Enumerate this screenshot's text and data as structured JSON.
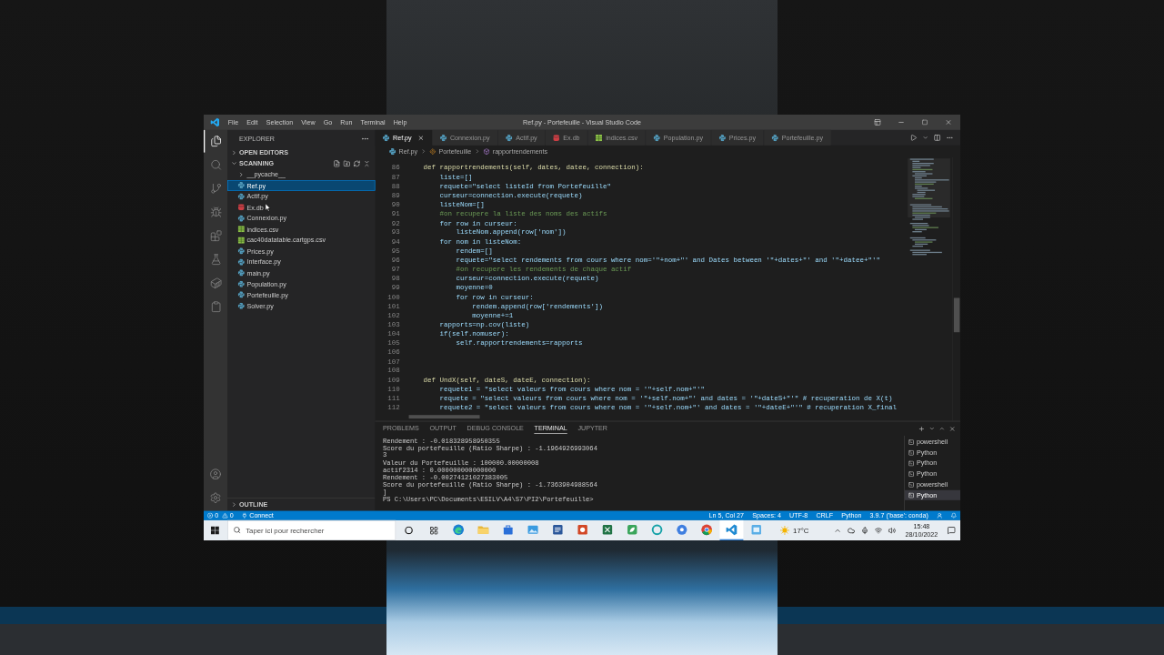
{
  "window": {
    "title": "Ref.py - Portefeuille - Visual Studio Code"
  },
  "menu": [
    "File",
    "Edit",
    "Selection",
    "View",
    "Go",
    "Run",
    "Terminal",
    "Help"
  ],
  "activity_bar": [
    {
      "selected": true
    },
    {
      "selected": false
    },
    {
      "selected": false
    },
    {
      "selected": false
    },
    {
      "selected": false
    },
    {
      "selected": false
    },
    {
      "selected": false
    },
    {
      "selected": false
    }
  ],
  "sidebar": {
    "title": "EXPLORER",
    "open_editors": {
      "label": "OPEN EDITORS",
      "expanded": false
    },
    "folder": {
      "label": "SCANNING",
      "expanded": true
    },
    "files": [
      {
        "name": "__pycache__",
        "kind": "folder",
        "selected": false
      },
      {
        "name": "Ref.py",
        "kind": "python",
        "selected": true
      },
      {
        "name": "Actif.py",
        "kind": "python",
        "selected": false
      },
      {
        "name": "Ex.db",
        "kind": "database",
        "selected": false
      },
      {
        "name": "Connexion.py",
        "kind": "python",
        "selected": false
      },
      {
        "name": "indices.csv",
        "kind": "csv",
        "selected": false
      },
      {
        "name": "cac40datatable.cartgps.csv",
        "kind": "csv",
        "selected": false
      },
      {
        "name": "Prices.py",
        "kind": "python",
        "selected": false
      },
      {
        "name": "Interface.py",
        "kind": "python",
        "selected": false
      },
      {
        "name": "main.py",
        "kind": "python",
        "selected": false
      },
      {
        "name": "Population.py",
        "kind": "python",
        "selected": false
      },
      {
        "name": "Portefeuille.py",
        "kind": "python",
        "selected": false
      },
      {
        "name": "Solver.py",
        "kind": "python",
        "selected": false
      }
    ],
    "outline": {
      "label": "OUTLINE",
      "expanded": false
    }
  },
  "editor": {
    "tabs": [
      {
        "label": "Ref.py",
        "kind": "python",
        "selected": true
      },
      {
        "label": "Connexion.py",
        "kind": "python",
        "selected": false
      },
      {
        "label": "Actif.py",
        "kind": "python",
        "selected": false
      },
      {
        "label": "Ex.db",
        "kind": "database",
        "selected": false
      },
      {
        "label": "indices.csv",
        "kind": "csv",
        "selected": false
      },
      {
        "label": "Population.py",
        "kind": "python",
        "selected": false
      },
      {
        "label": "Prices.py",
        "kind": "python",
        "selected": false
      },
      {
        "label": "Portefeuille.py",
        "kind": "python",
        "selected": false
      }
    ],
    "breadcrumb": [
      {
        "label": "Ref.py",
        "kind": "file"
      },
      {
        "label": "Portefeuille",
        "kind": "class"
      },
      {
        "label": "rapportrendements",
        "kind": "method"
      }
    ],
    "lines": [
      {
        "number": "86",
        "kind": "def",
        "text": "    def rapportrendements(self, dates, datee, connection):"
      },
      {
        "number": "87",
        "kind": "code",
        "text": "        liste=[]"
      },
      {
        "number": "88",
        "kind": "code",
        "text": "        requete=\"select listeId from Portefeuille\""
      },
      {
        "number": "89",
        "kind": "code",
        "text": "        curseur=connection.execute(requete)"
      },
      {
        "number": "90",
        "kind": "code",
        "text": "        listeNom=[]"
      },
      {
        "number": "91",
        "kind": "comment",
        "text": "        #on recupere la liste des noms des actifs"
      },
      {
        "number": "92",
        "kind": "code",
        "text": "        for row in curseur:"
      },
      {
        "number": "93",
        "kind": "code",
        "text": "            listeNom.append(row['nom'])"
      },
      {
        "number": "94",
        "kind": "code",
        "text": "        for nom in listeNom:"
      },
      {
        "number": "95",
        "kind": "code",
        "text": "            rendem=[]"
      },
      {
        "number": "96",
        "kind": "code",
        "text": "            requete=\"select rendements from cours where nom='\"+nom+\"' and Dates between '\"+dates+\"' and '\"+datee+\"'\""
      },
      {
        "number": "97",
        "kind": "comment",
        "text": "            #on recupere les rendements de chaque actif"
      },
      {
        "number": "98",
        "kind": "code",
        "text": "            curseur=connection.execute(requete)"
      },
      {
        "number": "99",
        "kind": "code",
        "text": "            moyenne=0"
      },
      {
        "number": "100",
        "kind": "code",
        "text": "            for row in curseur:"
      },
      {
        "number": "101",
        "kind": "code",
        "text": "                rendem.append(row['rendements'])"
      },
      {
        "number": "102",
        "kind": "code",
        "text": "                moyenne+=1"
      },
      {
        "number": "103",
        "kind": "code",
        "text": "        rapports=np.cov(liste)"
      },
      {
        "number": "104",
        "kind": "code",
        "text": "        if(self.nomuser):"
      },
      {
        "number": "105",
        "kind": "code",
        "text": "            self.rapportrendements=rapports"
      },
      {
        "number": "106",
        "kind": "blank"
      },
      {
        "number": "107",
        "kind": "blank"
      },
      {
        "number": "108",
        "kind": "blank"
      },
      {
        "number": "109",
        "kind": "def",
        "text": "    def UndX(self, dateS, dateE, connection):"
      },
      {
        "number": "110",
        "kind": "code",
        "text": "        requete1 = \"select valeurs from cours where nom = '\"+self.nom+\"'\""
      },
      {
        "number": "111",
        "kind": "code",
        "text": "        requete = \"select valeurs from cours where nom = '\"+self.nom+\"' and dates = '\"+dateS+\"'\" # recuperation de X(t)"
      },
      {
        "number": "112",
        "kind": "code",
        "text": "        requete2 = \"select valeurs from cours where nom = '\"+self.nom+\"' and dates = '\"+dateE+\"'\" # recuperation X_final"
      }
    ]
  },
  "panel": {
    "tabs": [
      {
        "label": "PROBLEMS",
        "selected": false
      },
      {
        "label": "OUTPUT",
        "selected": false
      },
      {
        "label": "DEBUG CONSOLE",
        "selected": false
      },
      {
        "label": "TERMINAL",
        "selected": true
      },
      {
        "label": "JUPYTER",
        "selected": false
      }
    ],
    "terminal_lines": [
      "Rendement : -0.018328958950355",
      "Score du portefeuille (Ratio Sharpe) : -1.1964926993064",
      "3",
      "Valeur du Portefeuille : 100000.00000008",
      "actif2314 : 0.000000000000000",
      "Rendement : -0.00274121027383005",
      "Score du portefeuille (Ratio Sharpe) : -1.7363904988564",
      "]",
      "PS C:\\Users\\PC\\Documents\\ESILV\\A4\\S7\\PI2\\Portefeuille>"
    ],
    "terminals": [
      {
        "label": "powershell",
        "selected": false
      },
      {
        "label": "Python",
        "selected": false
      },
      {
        "label": "Python",
        "selected": false
      },
      {
        "label": "Python",
        "selected": false
      },
      {
        "label": "powershell",
        "selected": false
      },
      {
        "label": "Python",
        "selected": true
      }
    ]
  },
  "status_bar": {
    "errors": "0",
    "warnings": "0",
    "remote": "Connect",
    "items": [
      "Ln 5, Col 27",
      "Spaces: 4",
      "UTF-8",
      "CRLF",
      "Python",
      "3.9.7 ('base': conda)"
    ]
  },
  "taskbar": {
    "search_placeholder": "Taper ici pour rechercher",
    "apps": [
      {
        "selected": false
      },
      {
        "selected": false
      },
      {
        "selected": false
      },
      {
        "selected": false
      },
      {
        "selected": false
      },
      {
        "selected": false
      },
      {
        "selected": false
      },
      {
        "selected": false
      },
      {
        "selected": false
      },
      {
        "selected": false
      },
      {
        "selected": false
      },
      {
        "selected": true
      },
      {
        "selected": false
      }
    ],
    "weather": "17°C",
    "time": "15:48",
    "date": "28/10/2022"
  }
}
